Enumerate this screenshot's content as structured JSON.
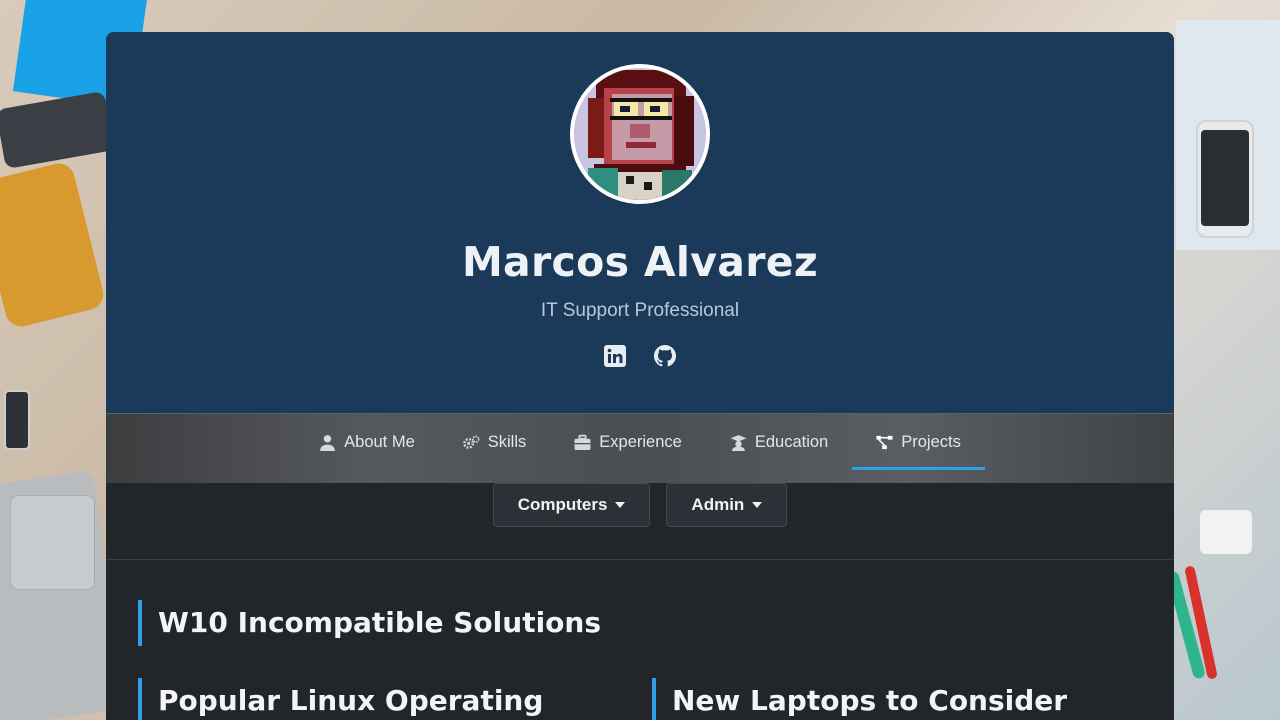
{
  "profile": {
    "name": "Marcos Alvarez",
    "title": "IT Support Professional",
    "social_icons": [
      "linkedin-icon",
      "github-icon"
    ]
  },
  "nav": {
    "items": [
      {
        "label": "About Me",
        "icon": "user-icon",
        "active": false
      },
      {
        "label": "Skills",
        "icon": "gears-icon",
        "active": false
      },
      {
        "label": "Experience",
        "icon": "briefcase-icon",
        "active": false
      },
      {
        "label": "Education",
        "icon": "graduation-icon",
        "active": false
      },
      {
        "label": "Projects",
        "icon": "project-diagram-icon",
        "active": true
      }
    ]
  },
  "filters": [
    {
      "label": "Computers"
    },
    {
      "label": "Admin"
    }
  ],
  "sections": [
    {
      "title": "W10 Incompatible Solutions"
    },
    {
      "title": "Popular Linux Operating"
    },
    {
      "title": "New Laptops to Consider"
    }
  ],
  "colors": {
    "header_bg": "#1b3a5a",
    "accent": "#2f9fe8",
    "content_bg": "#22252a"
  }
}
